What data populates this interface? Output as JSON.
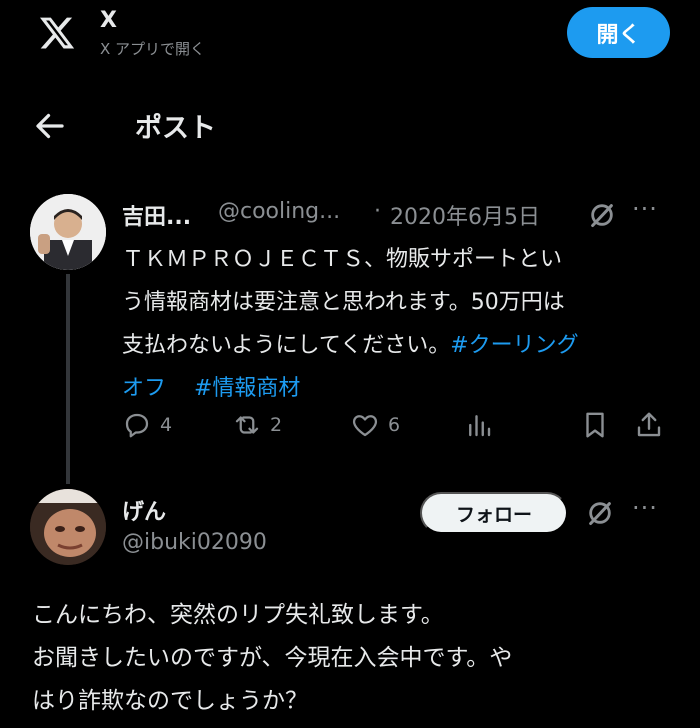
{
  "banner": {
    "app_name": "X",
    "subtitle": "X アプリで開く",
    "open_label": "開く",
    "logo_icon": "x-logo-icon"
  },
  "header": {
    "back_icon": "arrow-left-icon",
    "title": "ポスト"
  },
  "tweet1": {
    "display_name": "吉田...",
    "handle": "@cooling...",
    "separator": "·",
    "date": "2020年6月5日",
    "grok_icon": "grok-icon",
    "more_icon": "more-dots-icon",
    "more_glyph": "···",
    "body_lines": [
      "ＴＫＭＰＲＯＪＥＣＴＳ、物販サポートとい",
      "う情報商材は要注意と思われます。50万円は",
      "支払わないようにしてください。"
    ],
    "hashtag1_part1": "#クーリング",
    "hashtag1_part2": "オフ",
    "hashtag2": "#情報商材",
    "actions": {
      "replies": "4",
      "reposts": "2",
      "likes": "6"
    }
  },
  "tweet2": {
    "display_name": "げん",
    "handle": "@ibuki02090",
    "follow_label": "フォロー",
    "grok_icon": "grok-icon",
    "more_glyph": "···",
    "body_lines": [
      "こんにちわ、突然のリプ失礼致します。",
      "お聞きしたいのですが、今現在入会中です。や",
      "はり詐欺なのでしょうか？"
    ]
  },
  "colors": {
    "background": "#000000",
    "accent": "#1d9bf0",
    "muted": "#8b8f93",
    "text": "#e7e9ea"
  }
}
